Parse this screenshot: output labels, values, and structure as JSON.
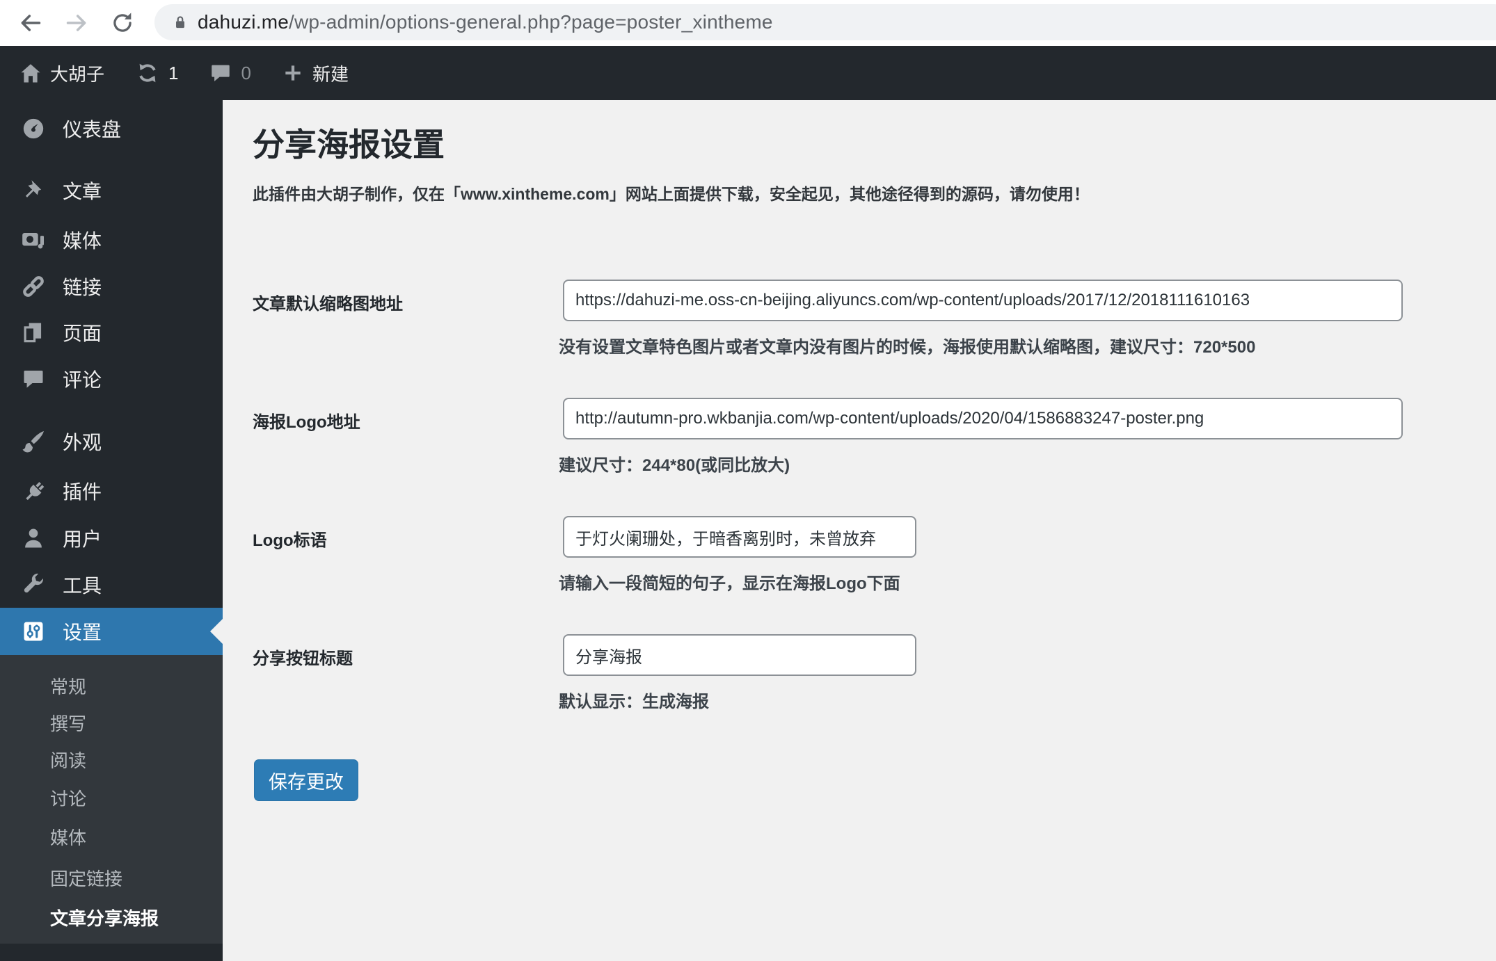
{
  "browser": {
    "url_domain": "dahuzi.me",
    "url_path": "/wp-admin/options-general.php?page=poster_xintheme"
  },
  "admin_bar": {
    "site_name": "大胡子",
    "update_count": "1",
    "comment_count": "0",
    "new_label": "新建"
  },
  "sidebar": {
    "items": [
      {
        "label": "仪表盘"
      },
      {
        "label": "文章"
      },
      {
        "label": "媒体"
      },
      {
        "label": "链接"
      },
      {
        "label": "页面"
      },
      {
        "label": "评论"
      },
      {
        "label": "外观"
      },
      {
        "label": "插件"
      },
      {
        "label": "用户"
      },
      {
        "label": "工具"
      },
      {
        "label": "设置"
      }
    ],
    "submenu": [
      "常规",
      "撰写",
      "阅读",
      "讨论",
      "媒体",
      "固定链接",
      "文章分享海报"
    ]
  },
  "main": {
    "title": "分享海报设置",
    "notice": "此插件由大胡子制作，仅在「www.xintheme.com」网站上面提供下载，安全起见，其他途径得到的源码，请勿使用！",
    "fields": [
      {
        "label": "文章默认缩略图地址",
        "value": "https://dahuzi-me.oss-cn-beijing.aliyuncs.com/wp-content/uploads/2017/12/2018111610163",
        "help": "没有设置文章特色图片或者文章内没有图片的时候，海报使用默认缩略图，建议尺寸：720*500"
      },
      {
        "label": "海报Logo地址",
        "value": "http://autumn-pro.wkbanjia.com/wp-content/uploads/2020/04/1586883247-poster.png",
        "help": "建议尺寸：244*80(或同比放大)"
      },
      {
        "label": "Logo标语",
        "value": "于灯火阑珊处，于暗香离别时，未曾放弃",
        "help": "请输入一段简短的句子，显示在海报Logo下面"
      },
      {
        "label": "分享按钮标题",
        "value": "分享海报",
        "help": "默认显示：生成海报"
      }
    ],
    "save_button": "保存更改"
  },
  "colors": {
    "sidebar_bg": "#23282d",
    "submenu_bg": "#32373c",
    "active_blue": "#2e77ae",
    "button_blue": "#2d7cb5",
    "content_bg": "#f1f1f1"
  }
}
